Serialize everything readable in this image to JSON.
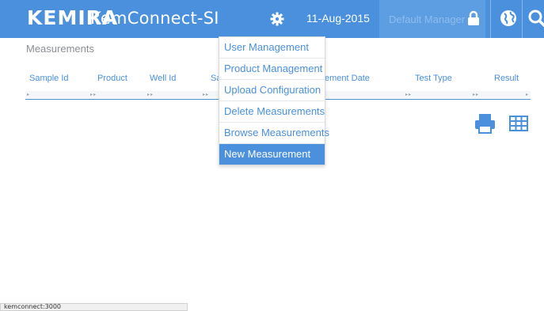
{
  "header": {
    "logo": "KEMIRA",
    "app_name": "KemConnect-SI",
    "date": "11-Aug-2015",
    "user_placeholder": "Default Manager"
  },
  "page": {
    "title": "Measurements"
  },
  "table": {
    "columns": [
      "Sample Id",
      "Product",
      "Well Id",
      "Sa",
      "ement Date",
      "Test Type",
      "Result"
    ]
  },
  "menu": {
    "items": [
      "User Management",
      "Product Management",
      "Upload Configuration",
      "Delete Measurements",
      "Browse Measurements",
      "New Measurement"
    ],
    "active_index": 5
  },
  "status_bar": {
    "url": "kemconnect:3000"
  },
  "colors": {
    "accent": "#4a90dc",
    "header_bg": "#4a90dc"
  },
  "icons": [
    "gear-icon",
    "lock-icon",
    "globe-icon",
    "search-icon",
    "print-icon",
    "grid-icon"
  ]
}
